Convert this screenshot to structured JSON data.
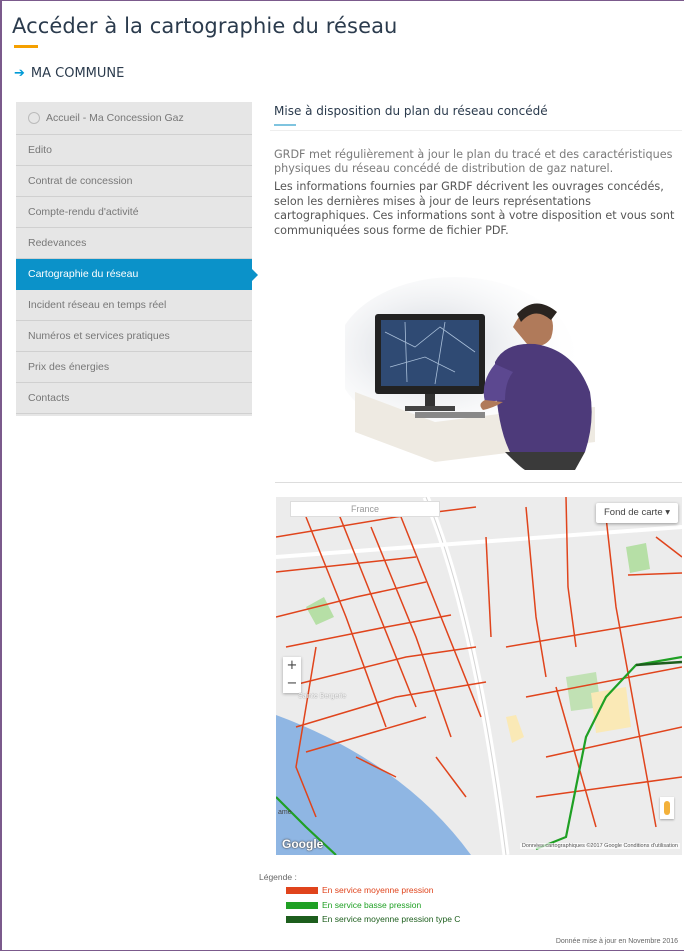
{
  "header": {
    "title": "Accéder à la cartographie du réseau",
    "commune": "MA COMMUNE"
  },
  "sidebar": {
    "items": [
      {
        "label": "Accueil - Ma Concession Gaz"
      },
      {
        "label": "Edito"
      },
      {
        "label": "Contrat de concession"
      },
      {
        "label": "Compte-rendu d'activité"
      },
      {
        "label": "Redevances"
      },
      {
        "label": "Cartographie du réseau",
        "active": true
      },
      {
        "label": "Incident réseau en temps réel"
      },
      {
        "label": "Numéros et services pratiques"
      },
      {
        "label": "Prix des énergies"
      },
      {
        "label": "Contacts"
      }
    ]
  },
  "main": {
    "heading": "Mise à disposition du plan du réseau concédé",
    "lead": "GRDF met régulièrement à jour le plan du tracé et des caractéristiques physiques du réseau concédé de distribution de gaz naturel.",
    "body": "Les informations fournies par GRDF décrivent les ouvrages concédés, selon les dernières mises à jour de leurs représentations cartographiques. Ces informations sont à votre disposition et vous sont communiquées sous forme de fichier PDF."
  },
  "map": {
    "search_value": "France",
    "basemap_button": "Fond de carte ▾",
    "zoom_in": "+",
    "zoom_out": "−",
    "google_logo": "Google",
    "attribution": "Données cartographiques ©2017 Google   Conditions d'utilisation",
    "place_label": "Sainte Bergerie",
    "edge_label": "ame"
  },
  "legend": {
    "title": "Légende :",
    "items": [
      {
        "label": "En service moyenne pression",
        "color": "#e0441c"
      },
      {
        "label": "En service basse pression",
        "color": "#1fa024"
      },
      {
        "label": "En service moyenne pression type C",
        "color": "#1d5e1d"
      }
    ]
  },
  "footer": {
    "note": "Donnée mise à jour en Novembre 2016"
  },
  "colors": {
    "accent_blue": "#0b92c9",
    "accent_orange": "#f5a000"
  }
}
